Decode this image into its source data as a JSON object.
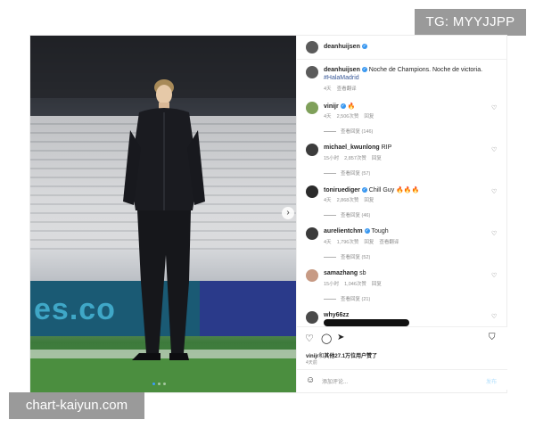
{
  "watermarks": {
    "top": "TG: MYYJJPP",
    "bottom": "chart-kaiyun.com"
  },
  "photo": {
    "board_text": "es.co",
    "carousel_dots": 3,
    "active_dot": 1
  },
  "header": {
    "username": "deanhuijsen"
  },
  "caption": {
    "username": "deanhuijsen",
    "text": "Noche de Champions. Noche de victoria.",
    "hashtag": "#HalaMadrid",
    "time": "4天",
    "translate": "查看翻译"
  },
  "comments": [
    {
      "username": "vinijr",
      "text": "🔥",
      "time": "4天",
      "likes": "2,506次赞",
      "reply": "回复",
      "replies": "查看回复 (146)"
    },
    {
      "username": "michael_kwunlong",
      "text": "RIP",
      "time": "15小时",
      "likes": "2,857次赞",
      "reply": "回复",
      "replies": "查看回复 (57)"
    },
    {
      "username": "toniruediger",
      "text": "Chill Guy 🔥🔥🔥",
      "time": "4天",
      "likes": "2,868次赞",
      "reply": "回复",
      "replies": "查看回复 (46)"
    },
    {
      "username": "aurelientchm",
      "text": "Tough",
      "time": "4天",
      "likes": "1,796次赞",
      "reply": "回复",
      "translate": "查看翻译",
      "replies": "查看回复 (52)"
    },
    {
      "username": "samazhang",
      "text": "sb",
      "time": "15小时",
      "likes": "1,046次赞",
      "reply": "回复",
      "replies": "查看回复 (21)"
    },
    {
      "username": "why66zz",
      "text": ""
    }
  ],
  "liked_by": {
    "prefix": "vinijr",
    "middle": "和",
    "suffix": "其他27.1万位用户赞了"
  },
  "post_time": "4天前",
  "add_comment": {
    "placeholder": "添加评论...",
    "post": "发布"
  },
  "colors": {
    "verified": "#3897f0",
    "hashtag": "#385898",
    "post_button": "#b2dffc"
  }
}
